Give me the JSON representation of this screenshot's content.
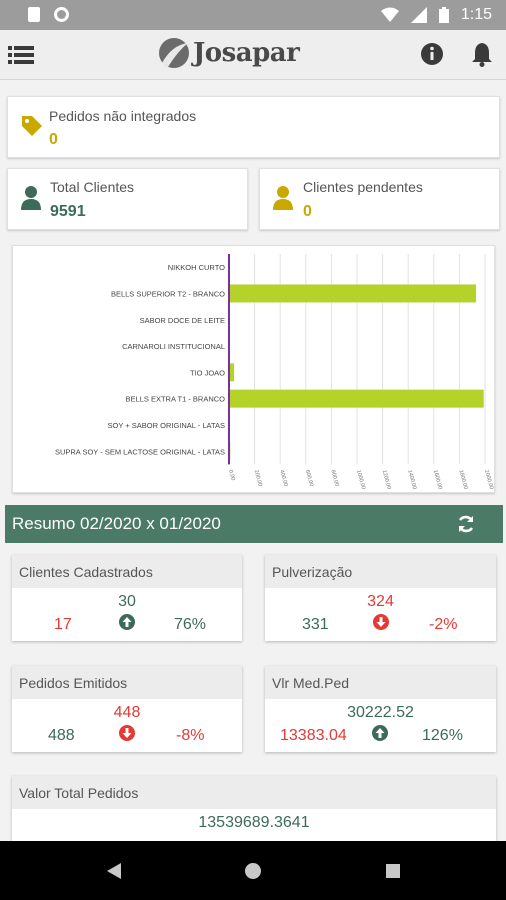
{
  "status_bar": {
    "time": "1:15"
  },
  "app": {
    "title": "Josapar"
  },
  "kpis": {
    "pedidos_nao_integrados": {
      "label": "Pedidos não integrados",
      "value": "0"
    },
    "total_clientes": {
      "label": "Total Clientes",
      "value": "9591"
    },
    "clientes_pendentes": {
      "label": "Clientes pendentes",
      "value": "0"
    }
  },
  "chart_data": {
    "type": "bar",
    "orientation": "horizontal",
    "categories": [
      "NIKKOH CURTO",
      "BELLS SUPERIOR T2 - BRANCO",
      "SABOR DOCE DE LEITE",
      "CARNAROLI INSTITUCIONAL",
      "TIO JOAO",
      "BELLS EXTRA T1 - BRANCO",
      "SOY + SABOR ORIGINAL - LATAS",
      "SUPRA SOY - SEM LACTOSE ORIGINAL - LATAS"
    ],
    "values": [
      0,
      1930,
      0,
      0,
      40,
      1990,
      0,
      10
    ],
    "xticks": [
      "0,00",
      "200,00",
      "400,00",
      "600,00",
      "800,00",
      "1000,00",
      "1200,00",
      "1400,00",
      "1600,00",
      "1800,00",
      "2000,00"
    ],
    "xlim": [
      0,
      2000
    ],
    "color": "#b5d22b",
    "axis_color": "#7b2fa3"
  },
  "resumo": {
    "title": "Resumo  02/2020 x 01/2020"
  },
  "stats": {
    "clientes_cadastrados": {
      "label": "Clientes Cadastrados",
      "top": "30",
      "left": "17",
      "right": "76%",
      "trend": "up"
    },
    "pulverizacao": {
      "label": "Pulverização",
      "top": "324",
      "left": "331",
      "right": "-2%",
      "trend": "down"
    },
    "pedidos_emitidos": {
      "label": "Pedidos Emitidos",
      "top": "448",
      "left": "488",
      "right": "-8%",
      "trend": "down"
    },
    "vlr_med_ped": {
      "label": "Vlr Med.Ped",
      "top": "30222.52",
      "left": "13383.04",
      "right": "126%",
      "trend": "up"
    },
    "valor_total_pedidos": {
      "label": "Valor Total Pedidos",
      "top": "13539689.3641"
    }
  },
  "colors": {
    "green": "#3d6b59",
    "red": "#e53935",
    "gold": "#c9a800"
  }
}
